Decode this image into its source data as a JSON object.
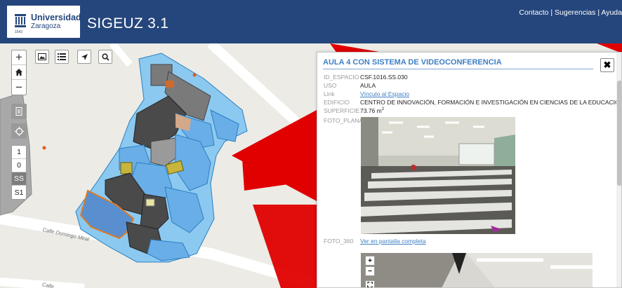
{
  "header": {
    "logo_line1": "Universidad",
    "logo_line2": "Zaragoza",
    "logo_small": "1542",
    "app_title": "SIGEUZ 3.1",
    "links": [
      "Contacto",
      "Sugerencias",
      "Ayuda"
    ]
  },
  "toolbar": {
    "zoom_in": "+",
    "home": "home-icon",
    "zoom_out": "−",
    "image_icon": "image-icon",
    "list_icon": "list-icon",
    "locate_icon": "navigate-icon",
    "search_icon": "search-icon",
    "doc_icon": "document-icon",
    "gps_icon": "target-icon"
  },
  "floors": [
    "1",
    "0",
    "SS",
    "S1"
  ],
  "active_floor": "SS",
  "streets": [
    "Calle Domingo Miral",
    "Calle"
  ],
  "popup": {
    "title": "AULA 4 CON SISTEMA DE VIDEOCONFERENCIA",
    "close": "✖",
    "fields": [
      {
        "key": "ID_ESPACIO",
        "value": "CSF.1016.SS.030"
      },
      {
        "key": "USO",
        "value": "AULA"
      },
      {
        "key": "Link",
        "value": "Vínculo al Espacio"
      },
      {
        "key": "EDIFICIO",
        "value": "CENTRO DE INNOVACIÓN, FORMACIÓN E INVESTIGACIÓN EN CIENCIAS DE LA EDUCACION - CIFICE"
      },
      {
        "key": "SUPERFICIE",
        "value": "73.76 m",
        "unit_sup": "2"
      },
      {
        "key": "FOTO_PLANA",
        "value": ""
      }
    ],
    "foto_360_key": "FOTO_360",
    "foto_360_link": "Ver en pantalla completa",
    "viewer_zoom_in": "+",
    "viewer_zoom_out": "−",
    "viewer_fullscreen": "⛶"
  },
  "colors": {
    "header": "#25467c",
    "accent": "#3d7fc4",
    "room_blue": "#6aaee8",
    "room_dark": "#4a4a4a",
    "red_area": "#e00000"
  }
}
